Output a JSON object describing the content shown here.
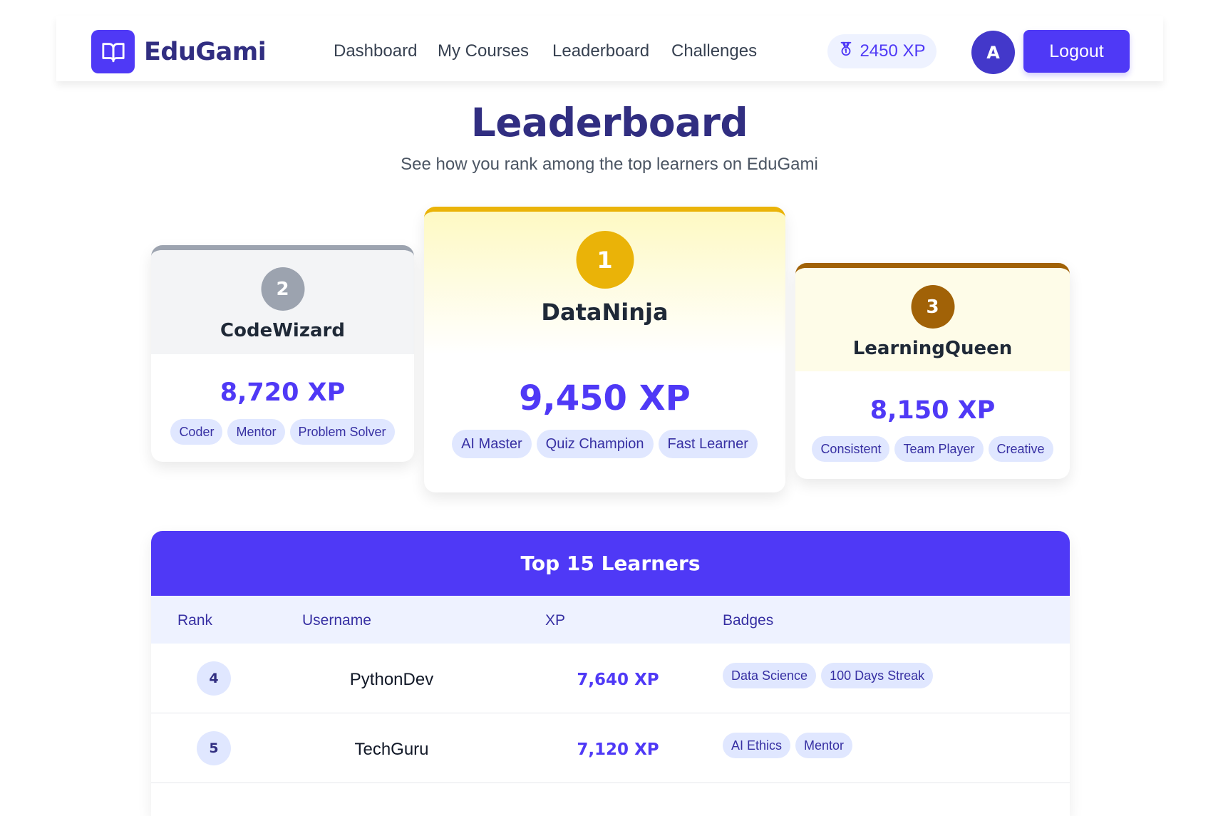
{
  "brand": {
    "name": "EduGami",
    "logo_icon": "book-open-icon",
    "accent": "#4f39f6"
  },
  "nav": {
    "links": [
      "Dashboard",
      "My Courses",
      "Leaderboard",
      "Challenges"
    ],
    "xp_label": "2450 XP",
    "xp_icon": "medal-icon",
    "avatar_initial": "A",
    "logout_label": "Logout"
  },
  "header": {
    "title": "Leaderboard",
    "subtitle": "See how you rank among the top learners on EduGami"
  },
  "podium": {
    "first": {
      "rank": "1",
      "name": "DataNinja",
      "xp": "9,450 XP",
      "badges": [
        "AI Master",
        "Quiz Champion",
        "Fast Learner"
      ],
      "color": "#eab308"
    },
    "second": {
      "rank": "2",
      "name": "CodeWizard",
      "xp": "8,720 XP",
      "badges": [
        "Coder",
        "Mentor",
        "Problem Solver"
      ],
      "color": "#9ca3af"
    },
    "third": {
      "rank": "3",
      "name": "LearningQueen",
      "xp": "8,150 XP",
      "badges": [
        "Consistent",
        "Team Player",
        "Creative"
      ],
      "color": "#a16207"
    }
  },
  "table": {
    "title": "Top 15 Learners",
    "columns": [
      "Rank",
      "Username",
      "XP",
      "Badges"
    ],
    "rows": [
      {
        "rank": "4",
        "username": "PythonDev",
        "xp": "7,640 XP",
        "badges": [
          "Data Science",
          "100 Days Streak"
        ]
      },
      {
        "rank": "5",
        "username": "TechGuru",
        "xp": "7,120 XP",
        "badges": [
          "AI Ethics",
          "Mentor"
        ]
      }
    ]
  }
}
